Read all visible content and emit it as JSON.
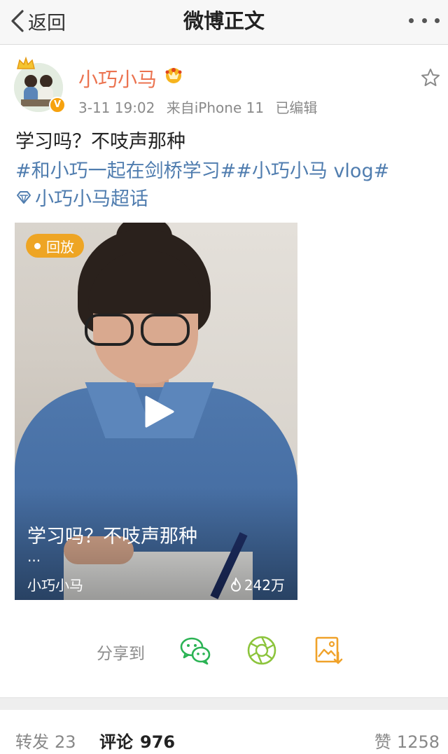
{
  "nav": {
    "back_label": "返回",
    "title": "微博正文"
  },
  "post": {
    "username": "小巧小马",
    "time": "3-11 19:02",
    "source": "来自iPhone 11",
    "edited": "已编辑",
    "text": "学习吗？不吱声那种",
    "hashtags": [
      "#和小巧一起在剑桥学习#",
      "#小巧小马 vlog#"
    ],
    "supertopic": "小巧小马超话"
  },
  "video": {
    "badge": "回放",
    "title": "学习吗？不吱声那种",
    "ellipsis": "...",
    "author": "小巧小马",
    "views": "242万"
  },
  "share": {
    "label": "分享到",
    "targets": [
      "wechat-icon",
      "moments-icon",
      "save-image-icon"
    ]
  },
  "footer": {
    "repost_label": "转发",
    "repost_count": "23",
    "comment_label": "评论",
    "comment_count": "976",
    "like_label": "赞",
    "like_count": "1258"
  },
  "colors": {
    "username": "#eb7350",
    "link": "#507daf",
    "badge": "#eea524",
    "wechat": "#2bb354",
    "moments": "#8cc43c",
    "save": "#f0a22a"
  }
}
